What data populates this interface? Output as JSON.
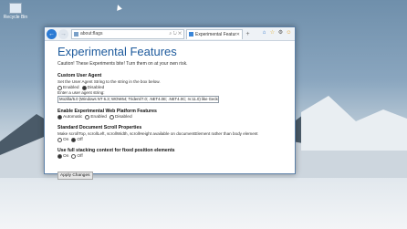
{
  "desktop": {
    "icon_label": "Recycle Bin"
  },
  "browser": {
    "address_url": "about:flags",
    "address_tools": "⌕ ↻ ✕",
    "tab_title": "Experimental Features",
    "tab_close": "✕",
    "new_tab": "+",
    "back_glyph": "←",
    "forward_glyph": "→",
    "toolbar_home": "⌂",
    "toolbar_star": "☆",
    "toolbar_gear": "⚙",
    "toolbar_smile": "☺"
  },
  "page": {
    "title": "Experimental Features",
    "caution": "Caution! These Experiments bite! Turn them on at your own risk.",
    "sections": [
      {
        "title": "Custom User Agent",
        "desc": "Set the User Agent String to the string in the box below.",
        "options": [
          "Enabled",
          "Disabled"
        ],
        "selected": 1,
        "input_label": "Enter a user agent string:",
        "input_value": "Mozilla/5.0 (Windows NT 6.3; WOW64; Trident/7.0; .NET4.0E; .NET4.0C; rv:11.0) like Gecko"
      },
      {
        "title": "Enable Experimental Web Platform Features",
        "options": [
          "Automatic",
          "Enabled",
          "Disabled"
        ],
        "selected": 0
      },
      {
        "title": "Standard Document Scroll Properties",
        "desc": "Make scrollTop, scrollLeft, scrollWidth, scrollHeight available on documentElement rather than body element",
        "options": [
          "On",
          "Off"
        ],
        "selected": 1
      },
      {
        "title": "Use full stacking context for fixed position elements",
        "options": [
          "On",
          "Off"
        ],
        "selected": 0
      }
    ],
    "apply_label": "Apply Changes"
  }
}
